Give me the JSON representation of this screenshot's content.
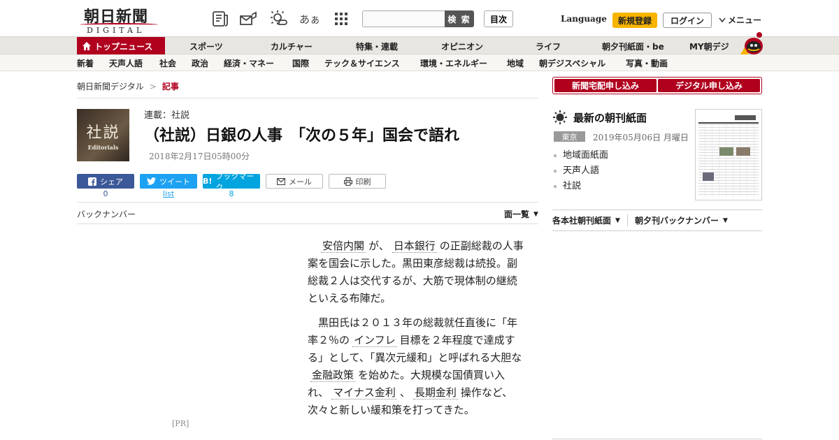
{
  "header": {
    "logo_main": "朝日新聞",
    "logo_sub": "DIGITAL",
    "font_size_label": "あぁ",
    "search_placeholder": "",
    "search_button": "検 索",
    "toc_button": "目次",
    "language": "Language",
    "signup": "新規登録",
    "login": "ログイン",
    "menu": "メニュー"
  },
  "nav_primary": {
    "top_news": "トップニュース",
    "items": [
      "スポーツ",
      "カルチャー",
      "特集・連載",
      "オピニオン",
      "ライフ",
      "朝夕刊紙面・be",
      "MY朝デジ"
    ]
  },
  "nav_secondary": {
    "items": [
      "新着",
      "天声人語",
      "社会",
      "政治",
      "経済・マネー",
      "国際",
      "テック＆サイエンス",
      "環境・エネルギー",
      "地域",
      "朝デジスペシャル",
      "写真・動画"
    ]
  },
  "breadcrumb": {
    "home": "朝日新聞デジタル",
    "separator": ">",
    "current": "記事"
  },
  "article": {
    "thumb_title": "社説",
    "thumb_sub": "Editorials",
    "series": "連載：社説",
    "title": "（社説）日銀の人事　「次の５年」国会で語れ",
    "date": "2018年2月17日05時00分",
    "backnumber": "バックナンバー",
    "page_list": "面一覧",
    "pr": "[PR]",
    "p1": {
      "k1": "安倍内閣",
      "t1": "が、",
      "k2": "日本銀行",
      "t2": "の正副総裁の人事案を国会に示した。黒田東彦総裁は続投。副総裁２人は交代するが、大筋で現体制の継続といえる布陣だ。"
    },
    "p2": {
      "t1": "黒田氏は２０１３年の総裁就任直後に「年率２％の",
      "k1": "インフレ",
      "t2": "目標を２年程度で達成する」として、「異次元緩和」と呼ばれる大胆な",
      "k2": "金融政策",
      "t3": "を始めた。大規模な国債買い入れ、",
      "k3": "マイナス金利",
      "t4": "、",
      "k4": "長期金利",
      "t5": "操作など、次々と新しい緩和策を打ってきた。"
    }
  },
  "share": {
    "facebook": "シェア",
    "facebook_count": "0",
    "twitter": "ツイート",
    "twitter_count": "list",
    "hatena_icon": "B!",
    "hatena": "ブックマーク",
    "hatena_count": "8",
    "mail": "メール",
    "print": "印刷"
  },
  "sidebar": {
    "subscribe_paper": "新聞宅配申し込み",
    "subscribe_digital": "デジタル申し込み",
    "latest_title": "最新の朝刊紙面",
    "region": "東京",
    "edition_date": "2019年05月06日 月曜日",
    "links": [
      "地域面紙面",
      "天声人語",
      "社説"
    ],
    "tab_edition": "各本社朝刊紙面",
    "tab_backnumber": "朝夕刊バックナンバー"
  },
  "colors": {
    "brand_red": "#b0001e",
    "signup_yellow": "#f7b400",
    "facebook": "#3b5998",
    "twitter": "#1da1f2",
    "hatena": "#00a4de"
  }
}
